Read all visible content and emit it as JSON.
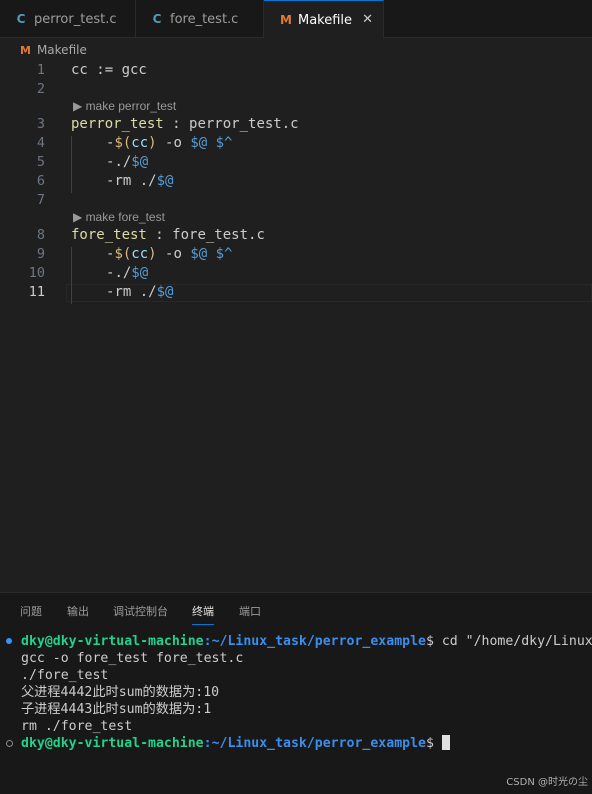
{
  "tabs": [
    {
      "icon": "C",
      "label": "perror_test.c"
    },
    {
      "icon": "C",
      "label": "fore_test.c"
    },
    {
      "icon": "M",
      "label": "Makefile",
      "close": "✕"
    }
  ],
  "breadcrumb": {
    "icon": "M",
    "label": "Makefile"
  },
  "editor": {
    "line_numbers": [
      "1",
      "2",
      "3",
      "4",
      "5",
      "6",
      "7",
      "8",
      "9",
      "10",
      "11"
    ],
    "codelens": [
      "▶ make perror_test",
      "▶ make fore_test"
    ],
    "lines": {
      "l1": {
        "a": "cc := gcc"
      },
      "l3": {
        "target": "perror_test",
        "sep": " : ",
        "dep": "perror_test.c"
      },
      "l4": {
        "dash": "-",
        "dollar": "$(",
        "var": "cc",
        "close": ")",
        "opt": " -o ",
        "auto1": "$@",
        "space": " ",
        "auto2": "$^"
      },
      "l5": {
        "dash": "-",
        "pre": "./",
        "auto": "$@"
      },
      "l6": {
        "dash": "-",
        "pre": "rm ./",
        "auto": "$@"
      },
      "l8": {
        "target": "fore_test",
        "sep": " : ",
        "dep": "fore_test.c"
      },
      "l9": {
        "dash": "-",
        "dollar": "$(",
        "var": "cc",
        "close": ")",
        "opt": " -o ",
        "auto1": "$@",
        "space": " ",
        "auto2": "$^"
      },
      "l10": {
        "dash": "-",
        "pre": "./",
        "auto": "$@"
      },
      "l11": {
        "dash": "-",
        "pre": "rm ./",
        "auto": "$@"
      }
    }
  },
  "panel": {
    "tabs": [
      "问题",
      "输出",
      "调试控制台",
      "终端",
      "端口"
    ],
    "active_tab": "终端",
    "terminal": {
      "prompt_user": "dky@dky-virtual-machine",
      "prompt_colon": ":",
      "prompt_path": "~/Linux_task/perror_example",
      "prompt_end": "$ ",
      "command": "cd \"/home/dky/Linux",
      "output": [
        "gcc -o fore_test fore_test.c",
        "./fore_test",
        "父进程4442此时sum的数据为:10",
        "子进程4443此时sum的数据为:1",
        "rm ./fore_test"
      ]
    }
  },
  "watermark": "CSDN @时光の尘",
  "colors": {
    "accent": "#0078d4",
    "prompt_user": "#23d18b",
    "prompt_path": "#3b8eea",
    "target": "#dcdcaa",
    "variable": "#9cdcfe",
    "automatic": "#569cd6"
  }
}
